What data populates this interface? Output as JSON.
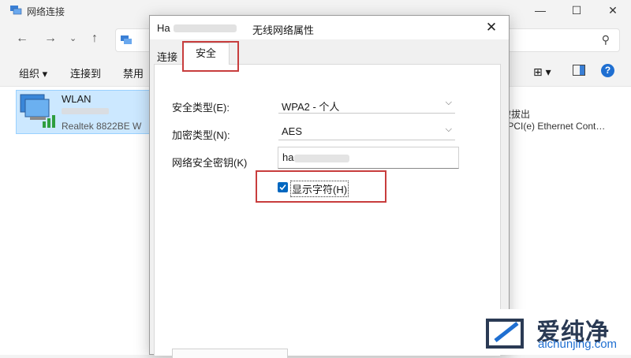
{
  "explorer": {
    "title": "网络连接",
    "toolbar": {
      "organize": "组织 ▾",
      "connect_to": "连接到",
      "disable": "禁用"
    },
    "wlan": {
      "name": "WLAN",
      "adapter": "Realtek 8822BE W"
    },
    "ethernet": {
      "status": "被拔出",
      "adapter": ") PCI(e) Ethernet Cont…"
    }
  },
  "dialog": {
    "title_prefix": "Ha",
    "title_suffix": "无线网络属性",
    "tabs": [
      {
        "label": "连接"
      },
      {
        "label": "安全"
      }
    ],
    "security_type_label": "安全类型(E):",
    "security_type_value": "WPA2 - 个人",
    "encryption_type_label": "加密类型(N):",
    "encryption_type_value": "AES",
    "network_key_label": "网络安全密钥(K)",
    "network_key_value": "ha",
    "show_chars_label": "显示字符(H)",
    "show_chars_checked": true
  },
  "colors": {
    "accent": "#0067c0",
    "highlight": "#c83d3d",
    "selection": "#cce8ff"
  },
  "watermark": {
    "brand": "爱纯净",
    "url": "aichunjing.com"
  }
}
